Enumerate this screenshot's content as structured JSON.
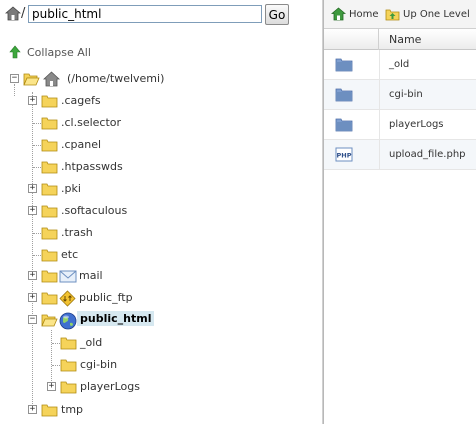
{
  "path_bar": {
    "path_value": "public_html",
    "separator": "/",
    "go_label": "Go",
    "home_icon": "house-icon"
  },
  "tree": {
    "collapse_all_label": "Collapse All",
    "root_label": "(/home/twelvemi)",
    "items": {
      "cagefs": ".cagefs",
      "cl_selector": ".cl.selector",
      "cpanel": ".cpanel",
      "htpasswds": ".htpasswds",
      "pki": ".pki",
      "softaculous": ".softaculous",
      "trash": ".trash",
      "etc": "etc",
      "mail": "mail",
      "public_ftp": "public_ftp",
      "public_html": "public_html",
      "old": "_old",
      "cgi_bin": "cgi-bin",
      "playerlogs": "playerLogs",
      "tmp": "tmp"
    },
    "expand_symbol": "+",
    "collapse_symbol": "−"
  },
  "toolbar": {
    "home_label": "Home",
    "up_label": "Up One Level"
  },
  "file_list": {
    "column_name": "Name",
    "rows": [
      {
        "name": "_old",
        "icon": "folder-icon"
      },
      {
        "name": "cgi-bin",
        "icon": "folder-icon"
      },
      {
        "name": "playerLogs",
        "icon": "folder-icon"
      },
      {
        "name": "upload_file.php",
        "icon": "php-file-icon"
      }
    ]
  },
  "colors": {
    "folder": "#f0c000",
    "selected_bg": "#d6e8f0",
    "file_folder_blue": "#6d8fc0"
  }
}
